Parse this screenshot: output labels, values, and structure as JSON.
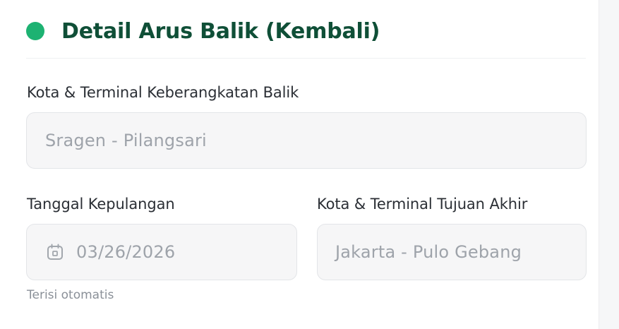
{
  "section": {
    "title": "Detail Arus Balik (Kembali)",
    "accent_color": "#1db272",
    "title_color": "#0f4f37"
  },
  "departure": {
    "label": "Kota & Terminal Keberangkatan Balik",
    "value": "Sragen - Pilangsari"
  },
  "return_date": {
    "label": "Tanggal Kepulangan",
    "value": "03/26/2026",
    "icon": "calendar-icon",
    "hint": "Terisi otomatis"
  },
  "destination": {
    "label": "Kota & Terminal Tujuan Akhir",
    "value": "Jakarta - Pulo Gebang"
  }
}
